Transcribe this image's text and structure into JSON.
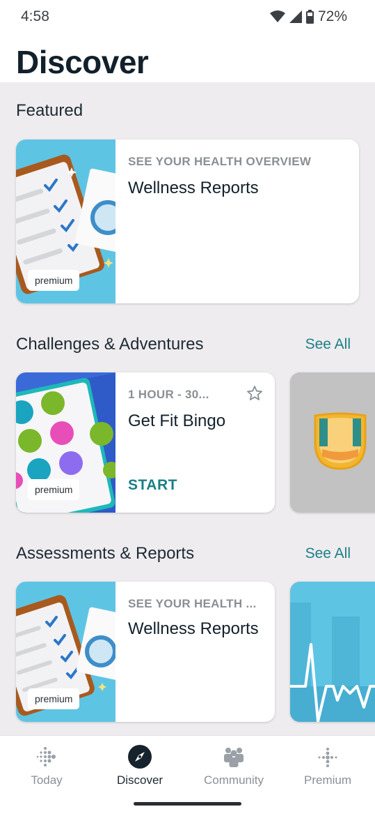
{
  "status": {
    "time": "4:58",
    "battery": "72%"
  },
  "page": {
    "title": "Discover"
  },
  "featured": {
    "title": "Featured",
    "card": {
      "eyebrow": "SEE YOUR HEALTH OVERVIEW",
      "title": "Wellness Reports",
      "badge": "premium"
    }
  },
  "challenges": {
    "title": "Challenges & Adventures",
    "see_all": "See All",
    "card": {
      "eyebrow": "1 HOUR - 30...",
      "title": "Get Fit Bingo",
      "action": "START",
      "badge": "premium"
    }
  },
  "assessments": {
    "title": "Assessments & Reports",
    "see_all": "See All",
    "card": {
      "eyebrow": "SEE YOUR HEALTH ...",
      "title": "Wellness Reports",
      "badge": "premium"
    }
  },
  "nav": {
    "items": [
      {
        "label": "Today",
        "icon": "fitbit-dots-icon"
      },
      {
        "label": "Discover",
        "icon": "compass-icon",
        "active": true
      },
      {
        "label": "Community",
        "icon": "people-icon"
      },
      {
        "label": "Premium",
        "icon": "premium-dots-icon"
      }
    ]
  },
  "colors": {
    "accent": "#1b7f86",
    "background": "#eeecef",
    "title": "#12202b"
  }
}
